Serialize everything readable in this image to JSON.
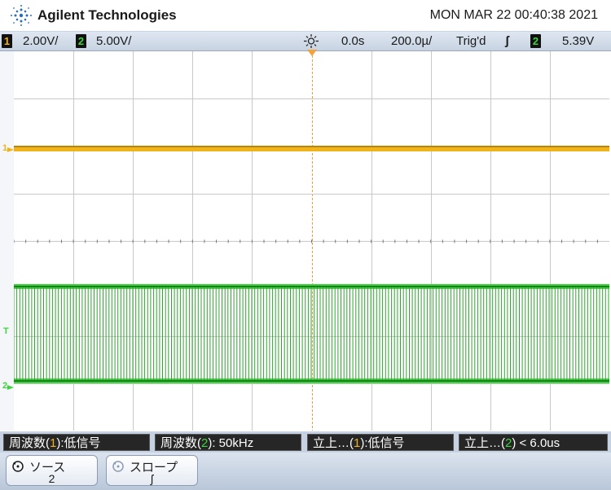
{
  "header": {
    "brand": "Agilent Technologies",
    "datetime": "MON MAR 22 00:40:38 2021"
  },
  "status": {
    "ch1_num": "1",
    "ch1_scale": "2.00V/",
    "ch2_num": "2",
    "ch2_scale": "5.00V/",
    "delay": "0.0s",
    "timebase": "200.0µ/",
    "trigger_state": "Trig'd",
    "trigger_slope_symbol": "ʃ",
    "trigger_source": "2",
    "trigger_level": "5.39V"
  },
  "markers": {
    "ch1": "1",
    "trig": "T",
    "ch2": "2"
  },
  "measurements": {
    "m1_label": "周波数(",
    "m1_ch": "1",
    "m1_rest": "):低信号",
    "m2_label": "周波数(",
    "m2_ch": "2",
    "m2_rest": "): 50kHz",
    "m3_label": "立上…(",
    "m3_ch": "1",
    "m3_rest": "):低信号",
    "m4_label": "立上…(",
    "m4_ch": "2",
    "m4_rest": ") < 6.0us"
  },
  "softkeys": {
    "source_title": "ソース",
    "source_value": "2",
    "slope_title": "スロープ",
    "slope_value": "ʃ"
  },
  "colors": {
    "ch1": "#f2b21a",
    "ch2": "#3fd43f",
    "grid": "#c8c8c8",
    "center_line": "#e8a040"
  },
  "icons": {
    "logo": "agilent-spark-icon",
    "delay": "delay-sun-icon",
    "softkey": "rotary-knob-icon"
  }
}
